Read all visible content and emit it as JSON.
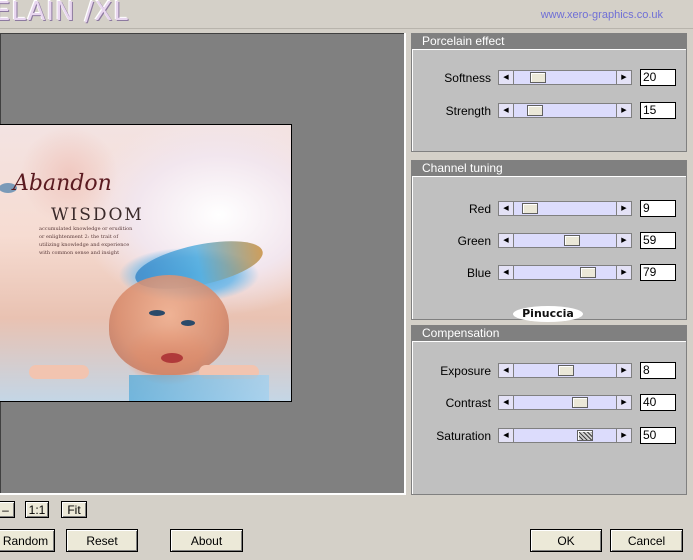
{
  "header": {
    "app_title": "ELAIN /XL",
    "url": "www.xero-graphics.co.uk"
  },
  "preview": {
    "image_title": "Abandon",
    "image_subtitle": "WISDOM",
    "image_body": "accumulated knowledge or erudition or enlightenment 2: the trait of utilizing knowledge and experience with common sense and insight"
  },
  "zoom_controls": {
    "minus_label": "–",
    "one_to_one_label": "1:1",
    "fit_label": "Fit"
  },
  "buttons": {
    "random_label": "Random",
    "reset_label": "Reset",
    "about_label": "About",
    "ok_label": "OK",
    "cancel_label": "Cancel"
  },
  "panels": {
    "porcelain": {
      "title": "Porcelain effect",
      "sliders": [
        {
          "label": "Softness",
          "value": "20",
          "position": 0.2
        },
        {
          "label": "Strength",
          "value": "15",
          "position": 0.15
        }
      ]
    },
    "channel": {
      "title": "Channel tuning",
      "sliders": [
        {
          "label": "Red",
          "value": "9",
          "position": 0.09
        },
        {
          "label": "Green",
          "value": "59",
          "position": 0.59
        },
        {
          "label": "Blue",
          "value": "79",
          "position": 0.79
        }
      ]
    },
    "compensation": {
      "title": "Compensation",
      "sliders": [
        {
          "label": "Exposure",
          "value": "8",
          "position": 0.54
        },
        {
          "label": "Contrast",
          "value": "40",
          "position": 0.7
        },
        {
          "label": "Saturation",
          "value": "50",
          "position": 0.75
        }
      ]
    }
  },
  "signature": "Pinuccia",
  "icons": {
    "slider_left": "arrow-left-icon",
    "slider_right": "arrow-right-icon"
  }
}
